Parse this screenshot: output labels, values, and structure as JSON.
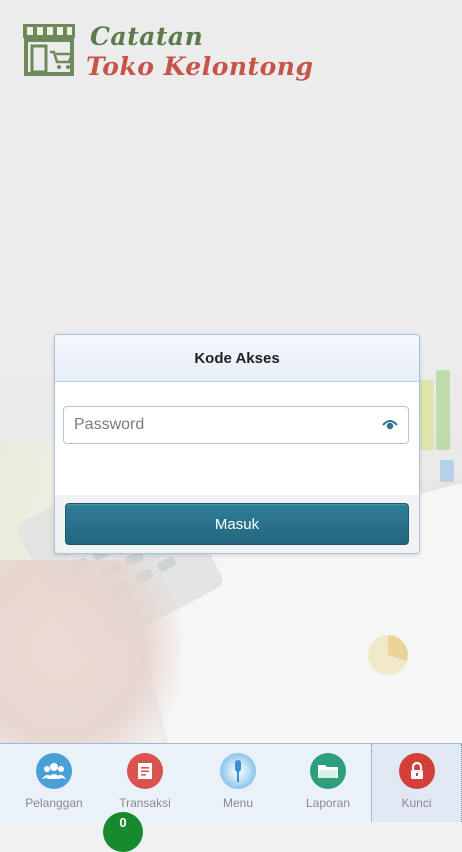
{
  "app": {
    "logo_line1": "Catatan",
    "logo_line2": "Toko Kelontong"
  },
  "dialog": {
    "title": "Kode Akses",
    "password_placeholder": "Password",
    "password_value": "",
    "submit_label": "Masuk"
  },
  "nav": {
    "items": [
      {
        "label": "Pelanggan",
        "icon": "users-icon",
        "color": "#4a9fd8"
      },
      {
        "label": "Transaksi",
        "icon": "receipt-icon",
        "color": "#d9534f"
      },
      {
        "label": "Menu",
        "icon": "microphone-icon",
        "color": "#5aa9df"
      },
      {
        "label": "Laporan",
        "icon": "folder-icon",
        "color": "#2f9e7c"
      },
      {
        "label": "Kunci",
        "icon": "lock-icon",
        "color": "#d43f3a"
      }
    ],
    "active": "Kunci",
    "badge_count": "0"
  },
  "colors": {
    "accent": "#2a7390",
    "logo_green": "#5d7a4d",
    "logo_red": "#c65449"
  }
}
